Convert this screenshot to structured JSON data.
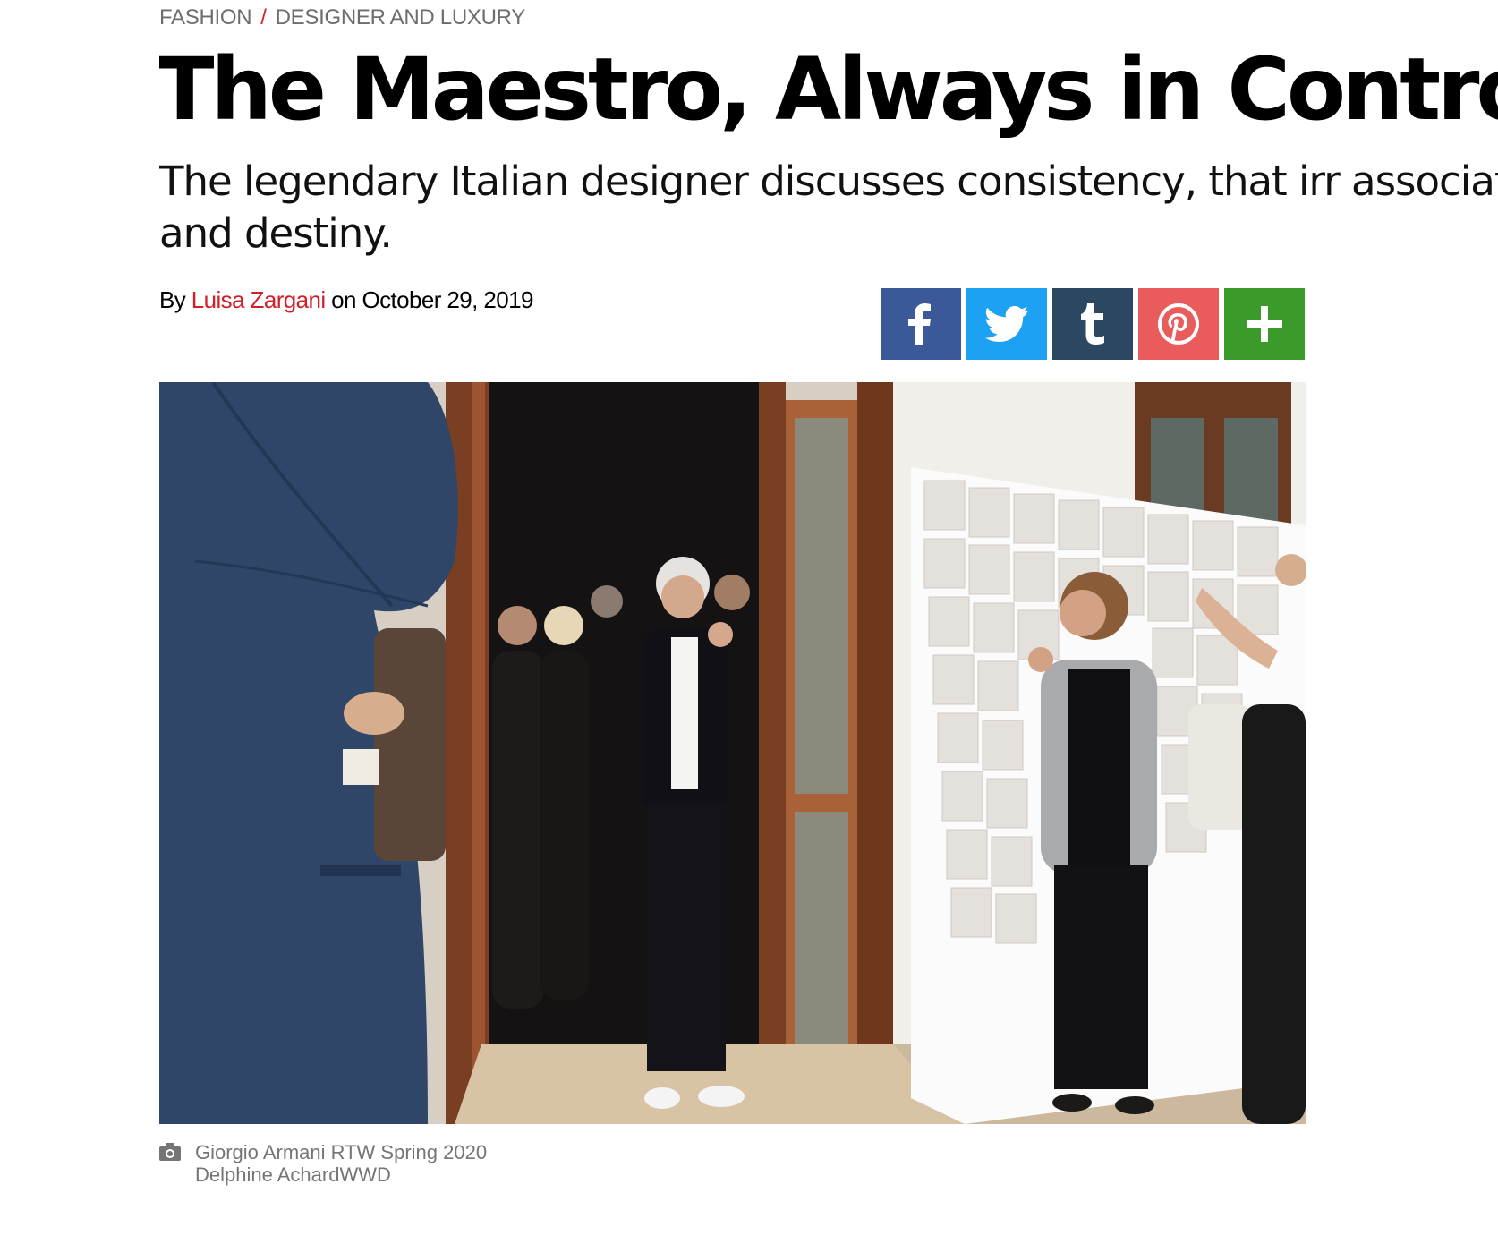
{
  "breadcrumb": {
    "category": "FASHION",
    "separator": "/",
    "subcategory": "DESIGNER AND LUXURY"
  },
  "headline": "The Maestro, Always in Control",
  "dek": "The legendary Italian designer discusses consistency, that irr association and destiny.",
  "byline": {
    "prefix": "By",
    "author": "Luisa Zargani",
    "date_prefix": "on",
    "date": "October 29, 2019"
  },
  "share": [
    {
      "name": "facebook",
      "icon": "facebook-icon",
      "color": "#3b5998"
    },
    {
      "name": "twitter",
      "icon": "twitter-icon",
      "color": "#1da1f2"
    },
    {
      "name": "tumblr",
      "icon": "tumblr-icon",
      "color": "#2c4762"
    },
    {
      "name": "pinterest",
      "icon": "pinterest-icon",
      "color": "#ea5b5b"
    },
    {
      "name": "more",
      "icon": "plus-icon",
      "color": "#3a9a2a"
    }
  ],
  "hero_image": {
    "description_icon": "photo-of-applauding-crowd"
  },
  "caption": {
    "icon": "camera-icon",
    "title": "Giorgio Armani RTW Spring 2020",
    "credit": "Delphine AchardWWD"
  },
  "colors": {
    "accent": "#d11f2a",
    "text": "#000000",
    "muted": "#6d6d6d"
  }
}
